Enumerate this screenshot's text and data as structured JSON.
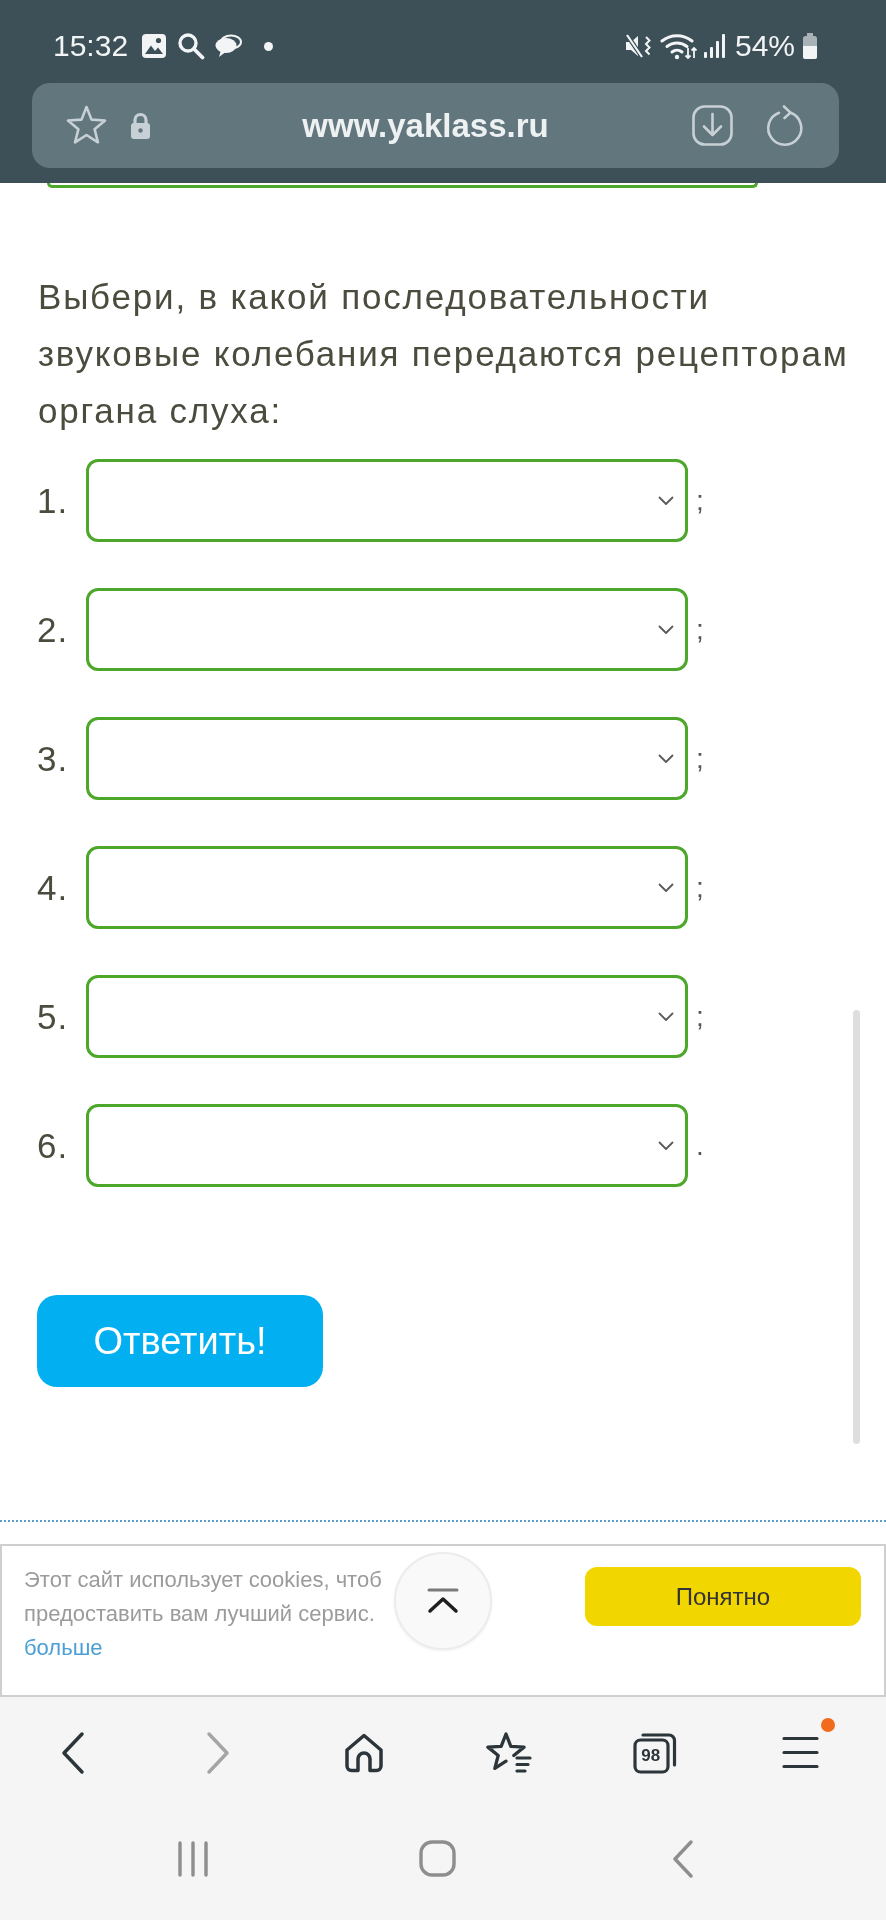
{
  "status_bar": {
    "time": "15:32",
    "battery": "54%"
  },
  "address_bar": {
    "url": "www.yaklass.ru"
  },
  "question": {
    "prompt": "Выбери, в какой последовательности звуковые колебания передаются рецепторам органа слуха:",
    "answers": [
      {
        "number": "1.",
        "punctuation": ";"
      },
      {
        "number": "2.",
        "punctuation": ";"
      },
      {
        "number": "3.",
        "punctuation": ";"
      },
      {
        "number": "4.",
        "punctuation": ";"
      },
      {
        "number": "5.",
        "punctuation": ";"
      },
      {
        "number": "6.",
        "punctuation": "."
      }
    ],
    "submit": "Ответить!"
  },
  "cookie_banner": {
    "lines": [
      "Этот сайт использует cookies, чтоб",
      "предоставить вам лучший сервис."
    ],
    "link": "больше",
    "accept": "Понятно"
  },
  "toolbar": [
    {
      "kind": "back",
      "disabled": false,
      "notification": false
    },
    {
      "kind": "forward",
      "disabled": true,
      "notification": false
    },
    {
      "kind": "home",
      "disabled": false,
      "notification": false
    },
    {
      "kind": "bookmarks",
      "disabled": false,
      "notification": false
    },
    {
      "kind": "tabs",
      "disabled": false,
      "notification": false,
      "count": "98"
    },
    {
      "kind": "menu",
      "disabled": false,
      "notification": true
    }
  ],
  "system_nav": [
    {
      "kind": "recents"
    },
    {
      "kind": "home"
    },
    {
      "kind": "back"
    }
  ]
}
